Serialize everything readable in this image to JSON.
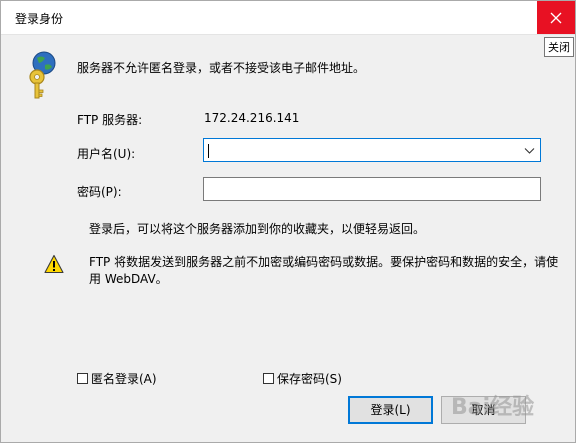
{
  "window": {
    "title": "登录身份",
    "close_tooltip": "关闭"
  },
  "message": "服务器不允许匿名登录，或者不接受该电子邮件地址。",
  "form": {
    "server_label": "FTP 服务器:",
    "server_value": "172.24.216.141",
    "username_label": "用户名(U):",
    "username_value": "",
    "password_label": "密码(P):",
    "password_value": ""
  },
  "note": "登录后，可以将这个服务器添加到你的收藏夹，以便轻易返回。",
  "warning": "FTP 将数据发送到服务器之前不加密或编码密码或数据。要保护密码和数据的安全，请使用 WebDAV。",
  "options": {
    "anonymous_label": "匿名登录(A)",
    "anonymous_checked": false,
    "save_password_label": "保存密码(S)",
    "save_password_checked": false
  },
  "buttons": {
    "login": "登录(L)",
    "cancel": "取消"
  },
  "watermark": "Bai经验",
  "colors": {
    "close_red": "#e81123",
    "focus_blue": "#0078d7",
    "warning_yellow": "#ffd800"
  }
}
